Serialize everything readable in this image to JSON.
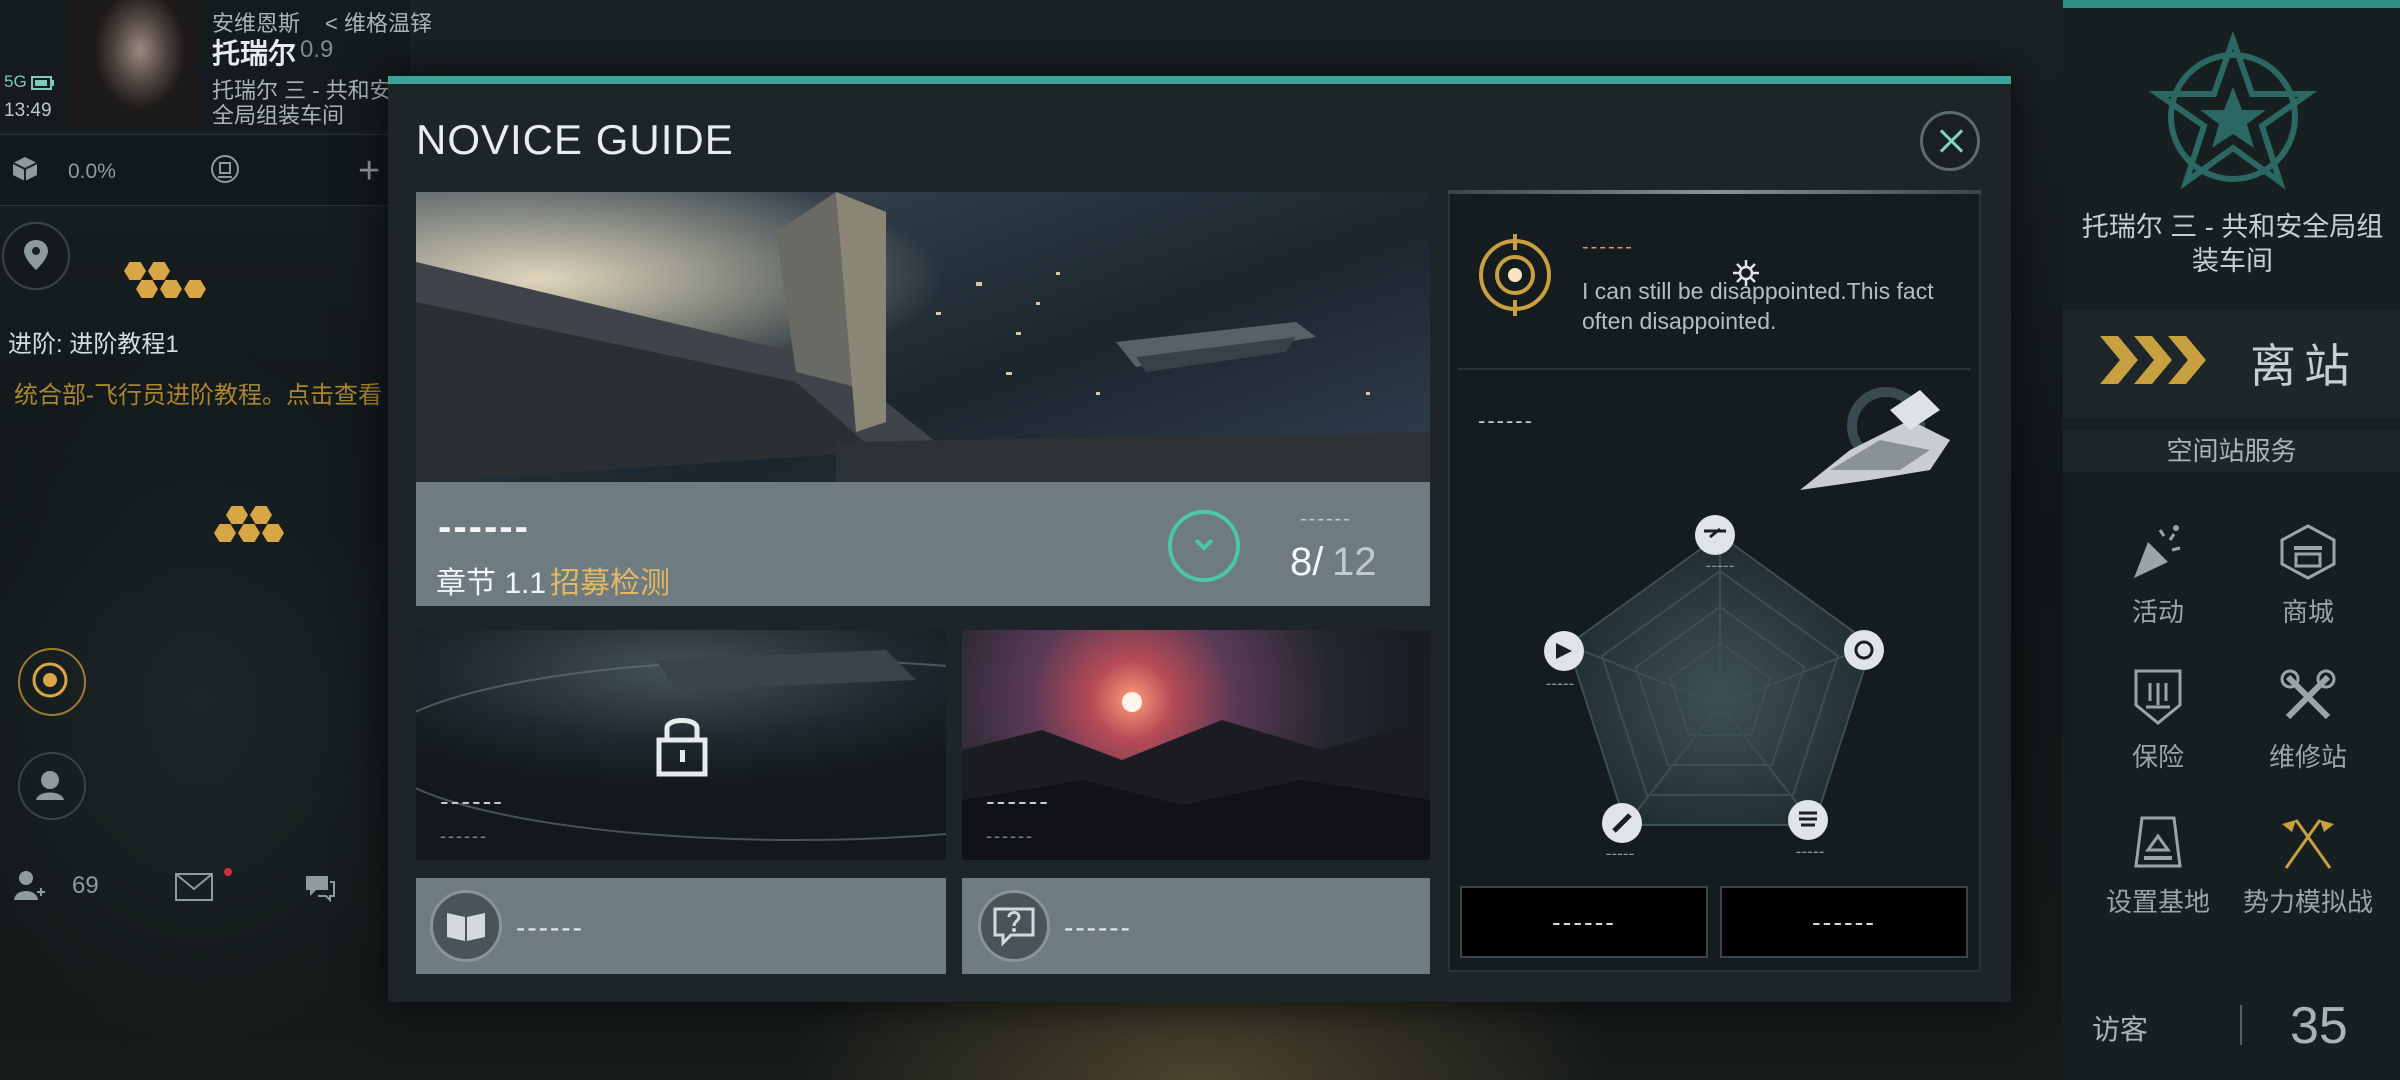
{
  "hud": {
    "signal": "5G",
    "clock": "13:49",
    "location_region": "安维恩斯",
    "location_sub": "< 维格温铎",
    "pilot_name": "托瑞尔",
    "security": "0.9",
    "station_short": "托瑞尔 三 - 共和安全局组装车间",
    "cargo_pct": "0.0%",
    "task_title": "进阶: 进阶教程1",
    "task_desc": "统合部-飞行员进阶教程。点击查看",
    "people_count": "69",
    "plus": "+"
  },
  "right_panel": {
    "station_name": "托瑞尔 三 - 共和安全局组装车间",
    "undock_label": "离站",
    "services_header": "空间站服务",
    "services": [
      {
        "label": "活动",
        "icon": "party-popper-icon"
      },
      {
        "label": "商城",
        "icon": "shop-icon"
      },
      {
        "label": "保险",
        "icon": "insurance-icon"
      },
      {
        "label": "维修站",
        "icon": "repair-icon"
      },
      {
        "label": "设置基地",
        "icon": "base-icon"
      },
      {
        "label": "势力模拟战",
        "icon": "crossed-flags-icon"
      }
    ],
    "visitors_label": "访客",
    "visitors_count": "35"
  },
  "dialog": {
    "title": "NOVICE GUIDE",
    "chapter": {
      "dash": "------",
      "label": "章节 1.1",
      "name": "招募检测",
      "progress_dash": "------",
      "progress_current": "8/",
      "progress_total": "12"
    },
    "cards": [
      {
        "title": "------",
        "sub": "------",
        "locked": true
      },
      {
        "title": "------",
        "sub": "------",
        "locked": false
      }
    ],
    "buttons": [
      {
        "label": "------",
        "icon": "book-icon"
      },
      {
        "label": "------",
        "icon": "help-icon"
      }
    ],
    "npc": {
      "dash": "------",
      "text": "I can still be disappointed.This fact often disappointed."
    },
    "ship_dash": "------",
    "radar_labels": [
      "-----",
      "-----",
      "-----",
      "-----",
      "-----"
    ],
    "actions": [
      "------",
      "------"
    ]
  },
  "colors": {
    "accent": "#3aa596",
    "gold": "#e3b960",
    "ring": "#4bc8a5"
  }
}
